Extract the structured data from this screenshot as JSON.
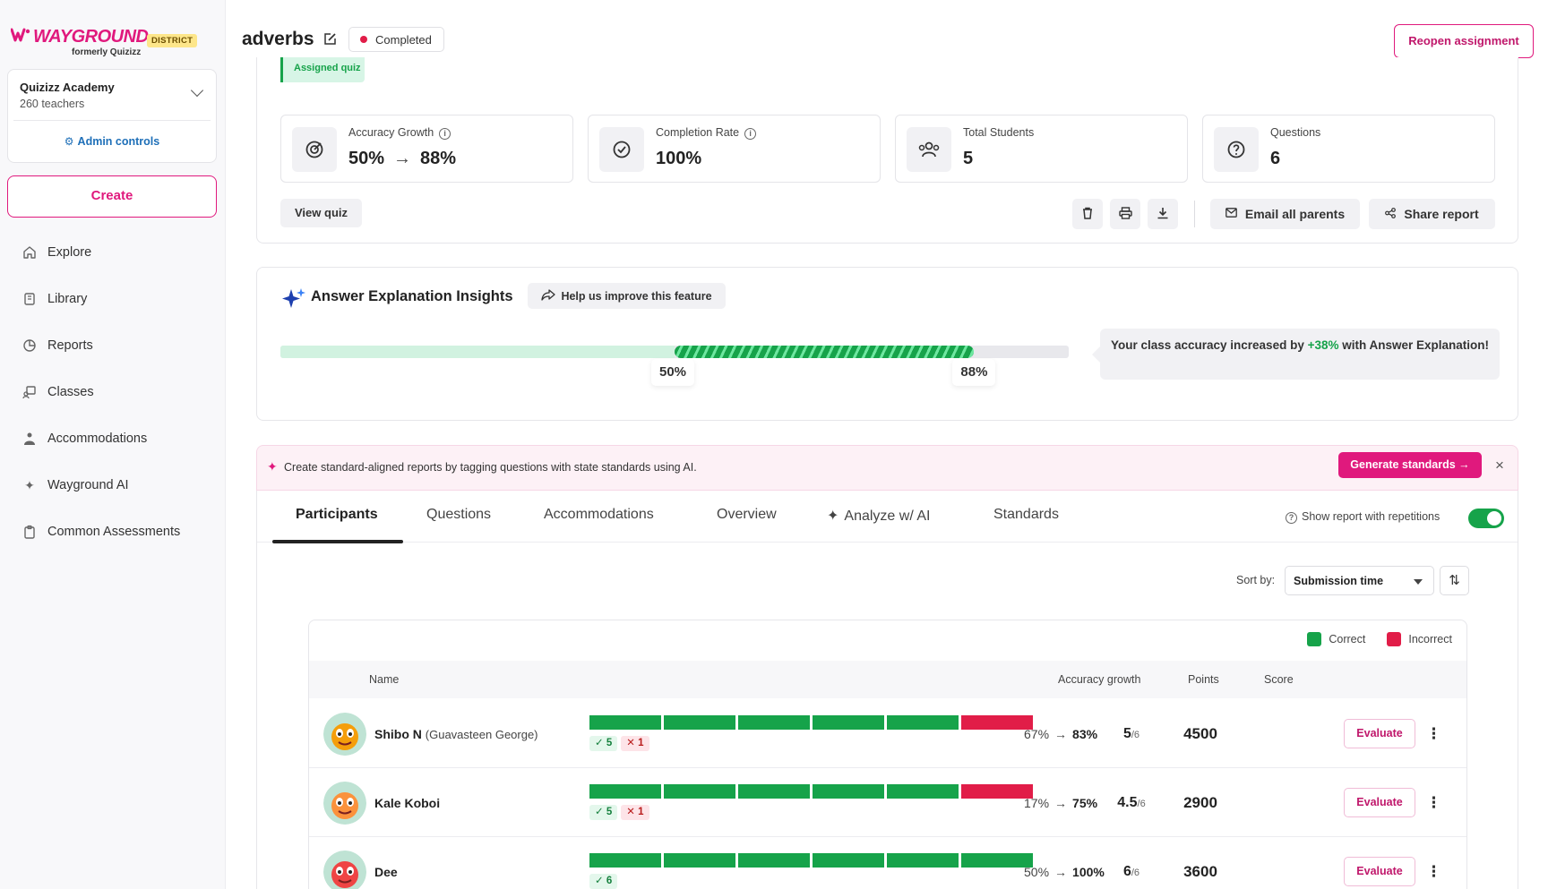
{
  "brand": {
    "name": "WAYGROUND",
    "badge": "DISTRICT",
    "subtitle": "formerly Quizizz"
  },
  "org": {
    "name": "Quizizz Academy",
    "teachers": "260 teachers",
    "admin_link": "Admin controls"
  },
  "sidebar": {
    "create_label": "Create",
    "items": [
      {
        "label": "Explore",
        "icon": "home-icon"
      },
      {
        "label": "Library",
        "icon": "library-icon"
      },
      {
        "label": "Reports",
        "icon": "reports-icon"
      },
      {
        "label": "Classes",
        "icon": "classes-icon"
      },
      {
        "label": "Accommodations",
        "icon": "accommodations-icon"
      },
      {
        "label": "Wayground AI",
        "icon": "sparkle-icon"
      },
      {
        "label": "Common Assessments",
        "icon": "clipboard-icon"
      }
    ]
  },
  "header": {
    "title": "adverbs",
    "status": "Completed",
    "reopen_label": "Reopen assignment"
  },
  "summary": {
    "assigned_tag": "Assigned quiz",
    "stats": [
      {
        "label": "Accuracy Growth",
        "from": "50%",
        "to": "88%",
        "icon": "target-icon"
      },
      {
        "label": "Completion Rate",
        "value": "100%",
        "icon": "check-circle-icon"
      },
      {
        "label": "Total Students",
        "value": "5",
        "icon": "users-icon"
      },
      {
        "label": "Questions",
        "value": "6",
        "icon": "question-icon"
      }
    ],
    "view_quiz_label": "View quiz",
    "email_label": "Email all parents",
    "share_label": "Share report"
  },
  "insights": {
    "title": "Answer Explanation Insights",
    "help_label": "Help us improve this feature",
    "start_pct": 50,
    "end_pct": 88,
    "start_label": "50%",
    "end_label": "88%",
    "message_prefix": "Your class accuracy increased by ",
    "message_highlight": "+38%",
    "message_suffix": " with Answer Explanation!"
  },
  "banner": {
    "text": "Create standard-aligned reports by tagging questions with state standards using AI.",
    "button_label": "Generate standards →"
  },
  "tabs": {
    "items": [
      "Participants",
      "Questions",
      "Accommodations",
      "Overview",
      "Analyze w/ AI",
      "Standards"
    ],
    "active": 0,
    "repetitions_label": "Show report with repetitions",
    "repetitions_on": true
  },
  "sort": {
    "label": "Sort by:",
    "value": "Submission time"
  },
  "table": {
    "legend": {
      "correct": "Correct",
      "incorrect": "Incorrect",
      "correct_color": "#16a34a",
      "incorrect_color": "#e11d48"
    },
    "headers": {
      "name": "Name",
      "growth": "Accuracy growth",
      "points": "Points",
      "score": "Score"
    },
    "evaluate_label": "Evaluate",
    "rows": [
      {
        "name": "Shibo N",
        "alias": "(Guavasteen George)",
        "answers": [
          1,
          1,
          1,
          1,
          1,
          0
        ],
        "correct": "5",
        "incorrect": "1",
        "growth_from": "67%",
        "growth_to": "83%",
        "points": "5",
        "points_total": "/6",
        "score": "4500",
        "avatar_color": "#f59e0b"
      },
      {
        "name": "Kale Koboi",
        "alias": "",
        "answers": [
          1,
          1,
          1,
          1,
          1,
          0
        ],
        "correct": "5",
        "incorrect": "1",
        "growth_from": "17%",
        "growth_to": "75%",
        "points": "4.5",
        "points_total": "/6",
        "score": "2900",
        "avatar_color": "#fb923c"
      },
      {
        "name": "Dee",
        "alias": "",
        "answers": [
          1,
          1,
          1,
          1,
          1,
          1
        ],
        "correct": "6",
        "incorrect": "",
        "growth_from": "50%",
        "growth_to": "100%",
        "points": "6",
        "points_total": "/6",
        "score": "3600",
        "avatar_color": "#ef4444"
      }
    ]
  }
}
